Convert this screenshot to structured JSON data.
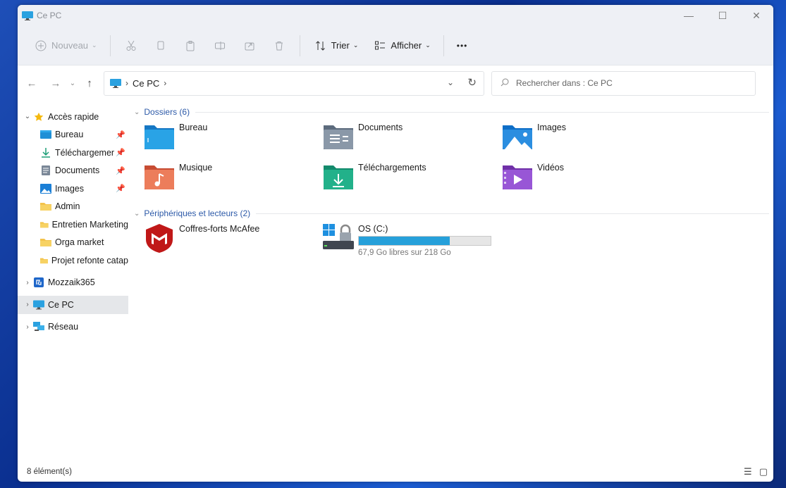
{
  "window": {
    "title": "Ce PC"
  },
  "toolbar": {
    "new_label": "Nouveau",
    "sort_label": "Trier",
    "view_label": "Afficher",
    "more_label": "•••"
  },
  "address": {
    "crumbs": [
      "Ce PC"
    ],
    "search_placeholder": "Rechercher dans : Ce PC"
  },
  "sidebar": {
    "quick_access": "Accès rapide",
    "quick_items": [
      {
        "label": "Bureau",
        "pinned": true,
        "icon": "desktop-folder-icon"
      },
      {
        "label": "Téléchargements",
        "pinned": true,
        "icon": "downloads-icon"
      },
      {
        "label": "Documents",
        "pinned": true,
        "icon": "documents-icon"
      },
      {
        "label": "Images",
        "pinned": true,
        "icon": "pictures-icon"
      },
      {
        "label": "Admin",
        "pinned": false,
        "icon": "folder-icon"
      },
      {
        "label": "Entretien Marketing",
        "pinned": false,
        "icon": "folder-icon"
      },
      {
        "label": "Orga market",
        "pinned": false,
        "icon": "folder-icon"
      },
      {
        "label": "Projet refonte catap",
        "pinned": false,
        "icon": "folder-icon"
      }
    ],
    "onedrive": "Mozzaik365",
    "this_pc": "Ce PC",
    "network": "Réseau"
  },
  "main": {
    "folders_header": "Dossiers (6)",
    "folders": [
      {
        "label": "Bureau",
        "icon": "desktop-folder-icon"
      },
      {
        "label": "Documents",
        "icon": "documents-folder-icon"
      },
      {
        "label": "Images",
        "icon": "pictures-folder-icon"
      },
      {
        "label": "Musique",
        "icon": "music-folder-icon"
      },
      {
        "label": "Téléchargements",
        "icon": "downloads-folder-icon"
      },
      {
        "label": "Vidéos",
        "icon": "videos-folder-icon"
      }
    ],
    "devices_header": "Périphériques et lecteurs (2)",
    "devices": [
      {
        "label": "Coffres-forts McAfee",
        "icon": "mcafee-icon"
      },
      {
        "label": "OS (C:)",
        "icon": "drive-icon",
        "free_text": "67,9 Go libres sur 218 Go",
        "used_fraction": 0.69
      }
    ]
  },
  "status": {
    "count": "8 élément(s)"
  },
  "colors": {
    "accent": "#26a0da",
    "link_blue": "#2d5aa8"
  }
}
